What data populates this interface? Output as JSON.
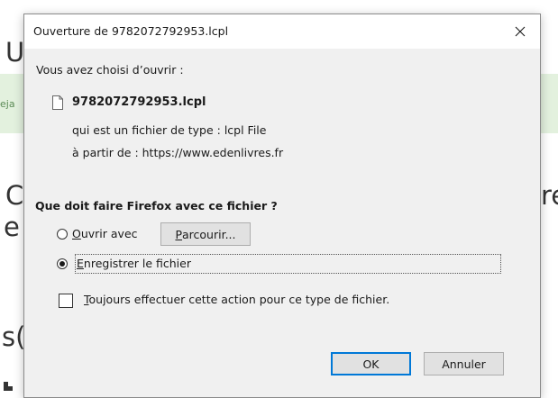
{
  "background": {
    "fragments": [
      "U",
      "eja",
      "C",
      "re",
      "e",
      "s("
    ]
  },
  "dialog": {
    "title": "Ouverture de 9782072792953.lcpl",
    "intro": "Vous avez choisi d’ouvrir :",
    "filename": "9782072792953.lcpl",
    "file_type_line": "qui est un fichier de type : lcpl File",
    "source_line": "à partir de : https://www.edenlivres.fr",
    "question": "Que doit faire Firefox avec ce fichier ?",
    "open_with": {
      "mnemonic": "O",
      "rest": "uvrir avec",
      "selected": false
    },
    "browse_button": {
      "mnemonic": "P",
      "rest": "arcourir..."
    },
    "save_file": {
      "mnemonic": "E",
      "rest": "nregistrer le fichier",
      "selected": true
    },
    "always_do": {
      "mnemonic": "T",
      "rest": "oujours effectuer cette action pour ce type de fichier.",
      "checked": false
    },
    "ok_label": "OK",
    "cancel_label": "Annuler"
  }
}
